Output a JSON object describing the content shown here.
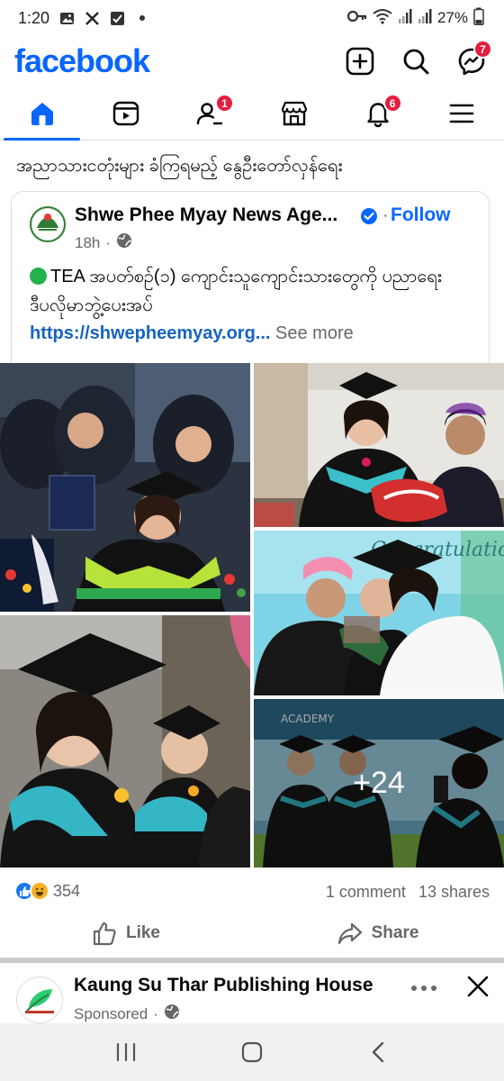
{
  "status_bar": {
    "time": "1:20",
    "battery": "27%",
    "left_icons": [
      "gallery-icon",
      "x-app-icon",
      "checkbox-icon",
      "dot-icon"
    ],
    "right_icons": [
      "key-icon",
      "wifi-icon",
      "signal-icon",
      "signal-icon",
      "battery-icon"
    ]
  },
  "header": {
    "logo": "facebook",
    "messenger_badge": "7"
  },
  "nav": {
    "friends_badge": "1",
    "notifications_badge": "6"
  },
  "feed": {
    "headline": "အညာသားငတုံးများ ခံကြရမည့် နွေဦးတော်လှန်ရေး",
    "shared_post": {
      "page_name": "Shwe Phee Myay News Age...",
      "follow_label": "Follow",
      "time": "18h",
      "text": "TEA အပတ်စဉ်(၁) ကျောင်းသူကျောင်းသားတွေကို ပညာရေးဒီပလိုမာဘွဲ့ပေးအပ်",
      "link": "https://shwepheemyay.org...",
      "see_more": "See more",
      "more_photos": "+24"
    },
    "reactions": {
      "count": "354",
      "comments": "1 comment",
      "shares": "13 shares"
    },
    "actions": {
      "like": "Like",
      "share": "Share"
    },
    "sponsored": {
      "page_name": "Kaung Su Thar Publishing House",
      "label": "Sponsored"
    }
  },
  "colors": {
    "brand": "#0866ff",
    "badge": "#e41e3f",
    "link": "#1565c0"
  }
}
